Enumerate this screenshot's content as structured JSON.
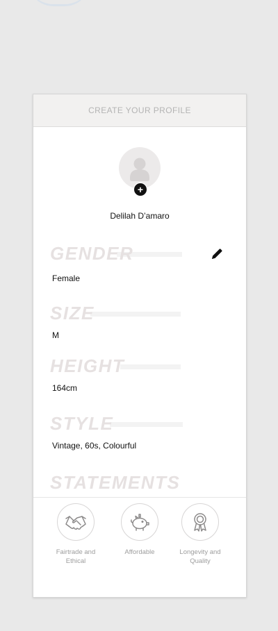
{
  "header": {
    "title": "CREATE YOUR PROFILE"
  },
  "profile": {
    "name": "Delilah D’amaro",
    "avatar_icon": "user-placeholder-icon",
    "add_photo_symbol": "+"
  },
  "sections": {
    "gender": {
      "title": "GENDER",
      "value": "Female"
    },
    "size": {
      "title": "SIZE",
      "value": "M"
    },
    "height": {
      "title": "HEIGHT",
      "value": "164cm"
    },
    "style": {
      "title": "STYLE",
      "value": "Vintage, 60s, Colourful"
    },
    "statements": {
      "title": "STATEMENTS"
    }
  },
  "actions": {
    "edit_icon": "pencil-icon"
  },
  "values": [
    {
      "icon": "handshake-icon",
      "label_line1": "Fairtrade and",
      "label_line2": "Ethical"
    },
    {
      "icon": "piggy-bank-icon",
      "label_line1": "Affordable",
      "label_line2": ""
    },
    {
      "icon": "award-ribbon-icon",
      "label_line1": "Longevity and",
      "label_line2": "Quality"
    }
  ],
  "colors": {
    "background": "#e9e9e9",
    "card": "#ffffff",
    "header_bg": "#f2f1f0",
    "section_title": "#e6e1e1",
    "text": "#111111",
    "muted_text": "#9d9d9d"
  }
}
